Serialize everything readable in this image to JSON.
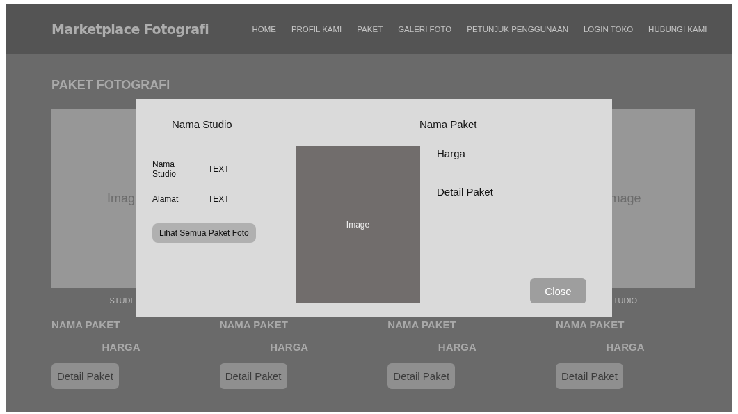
{
  "header": {
    "logo": "Marketplace Fotografi",
    "nav": [
      {
        "label": "HOME"
      },
      {
        "label": "PROFIL KAMI"
      },
      {
        "label": "PAKET"
      },
      {
        "label": "GALERI FOTO"
      },
      {
        "label": "PETUNJUK PENGGUNAAN"
      },
      {
        "label": "LOGIN TOKO"
      },
      {
        "label": "HUBUNGI KAMI"
      }
    ]
  },
  "page": {
    "title": "PAKET FOTOGRAFI",
    "cards": [
      {
        "image_label": "Imag",
        "studio": "STUDI",
        "package_name": "NAMA PAKET",
        "price": "HARGA",
        "button": "Detail Paket"
      },
      {
        "package_name": "NAMA PAKET",
        "price": "HARGA",
        "button": "Detail Paket"
      },
      {
        "package_name": "NAMA PAKET",
        "price": "HARGA",
        "button": "Detail Paket"
      },
      {
        "image_label": "mage",
        "studio": "TUDIO",
        "package_name": "NAMA PAKET",
        "price": "HARGA",
        "button": "Detail Paket"
      }
    ]
  },
  "modal": {
    "studio_heading": "Nama Studio",
    "package_heading": "Nama Paket",
    "fields": [
      {
        "label": "Nama Studio",
        "value": "TEXT"
      },
      {
        "label": "Alamat",
        "value": "TEXT"
      }
    ],
    "studio_button": "Lihat Semua Paket Foto",
    "image_label": "Image",
    "price": "Harga",
    "detail": "Detail Paket",
    "close_button": "Close"
  }
}
